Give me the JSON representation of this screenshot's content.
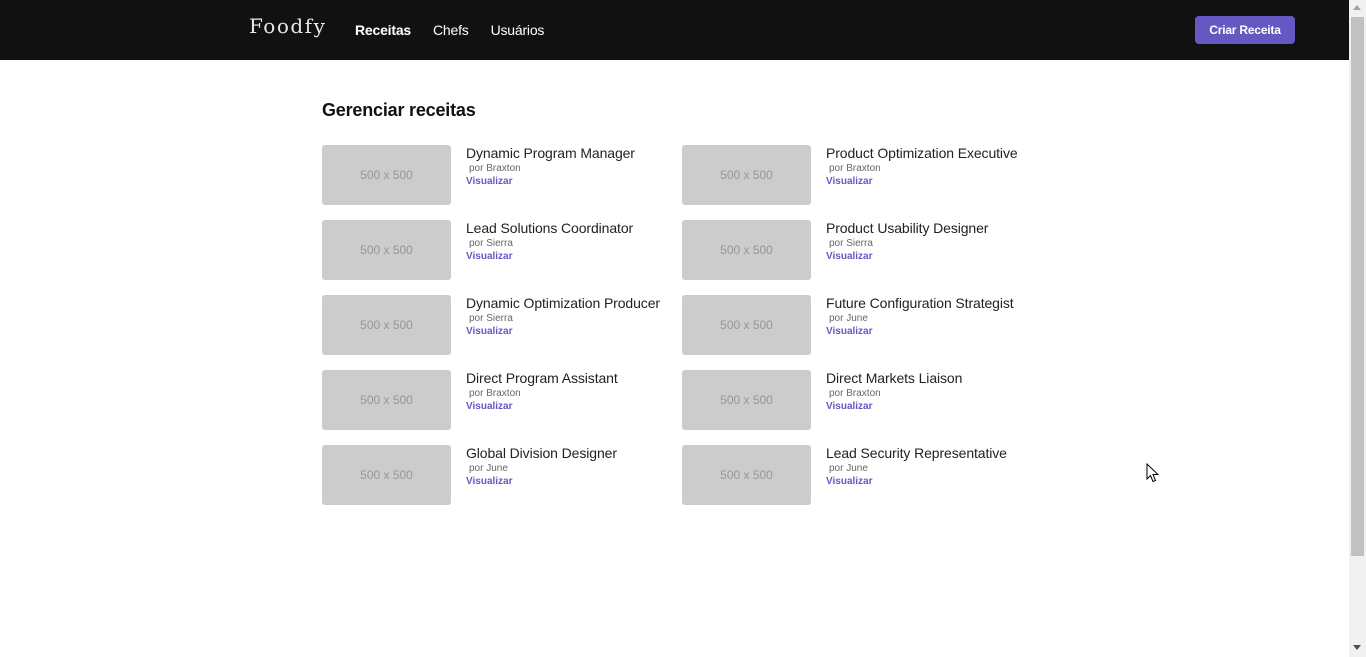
{
  "header": {
    "logo": "Foodfy",
    "nav": [
      {
        "label": "Receitas",
        "active": true
      },
      {
        "label": "Chefs",
        "active": false
      },
      {
        "label": "Usuários",
        "active": false
      }
    ],
    "create_button": "Criar Receita"
  },
  "main": {
    "title": "Gerenciar receitas",
    "recipes": [
      {
        "image_label": "500 x 500",
        "title": "Dynamic Program Manager",
        "author": "por Braxton",
        "link": "Visualizar"
      },
      {
        "image_label": "500 x 500",
        "title": "Product Optimization Executive",
        "author": "por Braxton",
        "link": "Visualizar"
      },
      {
        "image_label": "500 x 500",
        "title": "Lead Solutions Coordinator",
        "author": "por Sierra",
        "link": "Visualizar"
      },
      {
        "image_label": "500 x 500",
        "title": "Product Usability Designer",
        "author": "por Sierra",
        "link": "Visualizar"
      },
      {
        "image_label": "500 x 500",
        "title": "Dynamic Optimization Producer",
        "author": "por Sierra",
        "link": "Visualizar"
      },
      {
        "image_label": "500 x 500",
        "title": "Future Configuration Strategist",
        "author": "por June",
        "link": "Visualizar"
      },
      {
        "image_label": "500 x 500",
        "title": "Direct Program Assistant",
        "author": "por Braxton",
        "link": "Visualizar"
      },
      {
        "image_label": "500 x 500",
        "title": "Direct Markets Liaison",
        "author": "por Braxton",
        "link": "Visualizar"
      },
      {
        "image_label": "500 x 500",
        "title": "Global Division Designer",
        "author": "por June",
        "link": "Visualizar"
      },
      {
        "image_label": "500 x 500",
        "title": "Lead Security Representative",
        "author": "por June",
        "link": "Visualizar"
      }
    ]
  },
  "colors": {
    "header_bg": "#111111",
    "accent": "#6558c3",
    "placeholder_bg": "#cccccc"
  }
}
